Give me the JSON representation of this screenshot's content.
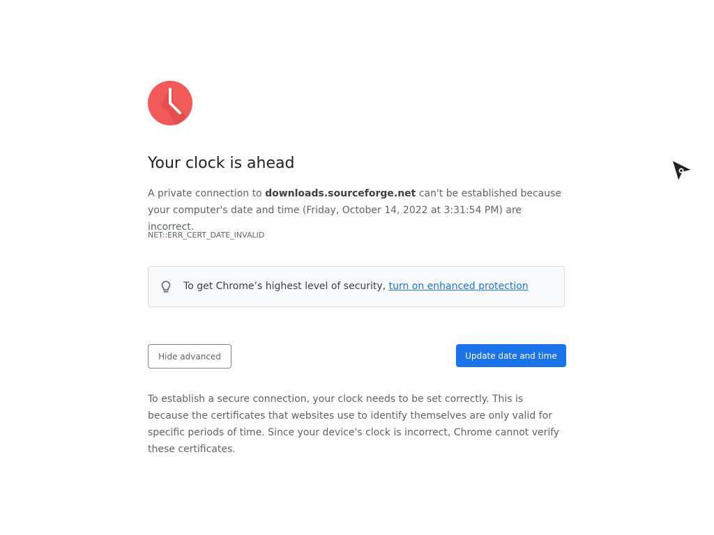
{
  "interstitial": {
    "icon": "clock-icon",
    "title": "Your clock is ahead",
    "message": {
      "prefix": "A private connection to ",
      "domain": "downloads.sourceforge.net",
      "suffix": " can't be established because your computer's date and time (Friday, October 14, 2022 at 3:31:54 PM) are incorrect."
    },
    "error_code": "NET::ERR_CERT_DATE_INVALID",
    "tip": {
      "icon": "lightbulb-icon",
      "text": "To get Chrome’s highest level of security, ",
      "link_text": "turn on enhanced protection"
    },
    "buttons": {
      "hide_advanced": "Hide advanced",
      "update_date_time": "Update date and time"
    },
    "details": "To establish a secure connection, your clock needs to be set correctly. This is because the certificates that websites use to identify themselves are only valid for specific periods of time. Since your device's clock is incorrect, Chrome cannot verify these certificates."
  },
  "colors": {
    "icon_red": "#f25a5a",
    "primary_blue": "#1a73e8",
    "title_text": "#202124",
    "body_text": "#5f6368"
  },
  "cursor": {
    "icon": "mouse-pointer-icon"
  }
}
